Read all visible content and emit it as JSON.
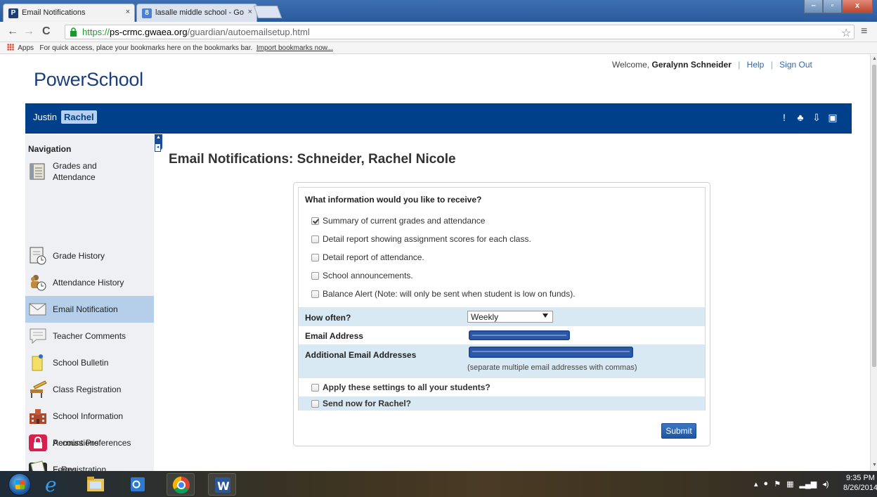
{
  "browser": {
    "tabs": [
      {
        "title": "Email Notifications",
        "favicon": "P",
        "favicon_color": "#1a3f7a"
      },
      {
        "title": "lasalle middle school - Go",
        "favicon": "8",
        "favicon_color": "#4a7fd4"
      }
    ],
    "close_glyph": "×",
    "url_scheme": "https://",
    "url_host": "ps-crmc.gwaea.org",
    "url_path": "/guardian/autoemailsetup.html",
    "bookmarks": {
      "apps_label": "Apps",
      "message": "For quick access, place your bookmarks here on the bookmarks bar.",
      "import_link": "Import bookmarks now..."
    }
  },
  "header": {
    "logo": "PowerSchool",
    "welcome_prefix": "Welcome,",
    "user_name": "Geralynn Schneider",
    "help": "Help",
    "sign_out": "Sign Out",
    "separator": "|"
  },
  "students": [
    "Justin",
    "Rachel"
  ],
  "selected_student": "Rachel",
  "nav": {
    "title": "Navigation",
    "items": [
      {
        "label": "Grades and Attendance",
        "icon": "gradebook-icon"
      },
      {
        "label": "Grade History",
        "icon": "grade-history-icon"
      },
      {
        "label": "Attendance History",
        "icon": "attendance-history-icon"
      },
      {
        "label": "Email Notification",
        "icon": "envelope-icon",
        "active": true
      },
      {
        "label": "Teacher Comments",
        "icon": "speech-bubble-icon"
      },
      {
        "label": "School Bulletin",
        "icon": "bulletin-icon"
      },
      {
        "label": "Class Registration",
        "icon": "pencil-desk-icon"
      },
      {
        "label": "School Information",
        "icon": "school-building-icon"
      },
      {
        "label": "Account Preferences",
        "icon": "user-icon"
      },
      {
        "label": "E-Registration",
        "icon": "id-card-icon"
      },
      {
        "label": "Permissions",
        "icon": "padlock-icon"
      },
      {
        "label": "Forms",
        "icon": "forms-icon"
      }
    ]
  },
  "main": {
    "title": "Email Notifications: Schneider, Rachel Nicole",
    "question": "What information would you like to receive?",
    "options": [
      {
        "label": "Summary of current grades and attendance",
        "checked": true
      },
      {
        "label": "Detail report showing assignment scores for each class.",
        "checked": false
      },
      {
        "label": "Detail report of attendance.",
        "checked": false
      },
      {
        "label": "School announcements.",
        "checked": false
      },
      {
        "label": "Balance Alert (Note: will only be sent when student is low on funds).",
        "checked": false
      }
    ],
    "how_often_label": "How often?",
    "how_often_value": "Weekly",
    "email_label": "Email Address",
    "additional_label": "Additional Email Addresses",
    "additional_hint": "(separate multiple email addresses with commas)",
    "apply_all_label": "Apply these settings to all your students?",
    "send_now_label": "Send now for Rachel?",
    "submit_label": "Submit"
  },
  "taskbar": {
    "time": "9:35 PM",
    "date": "8/26/2014"
  }
}
